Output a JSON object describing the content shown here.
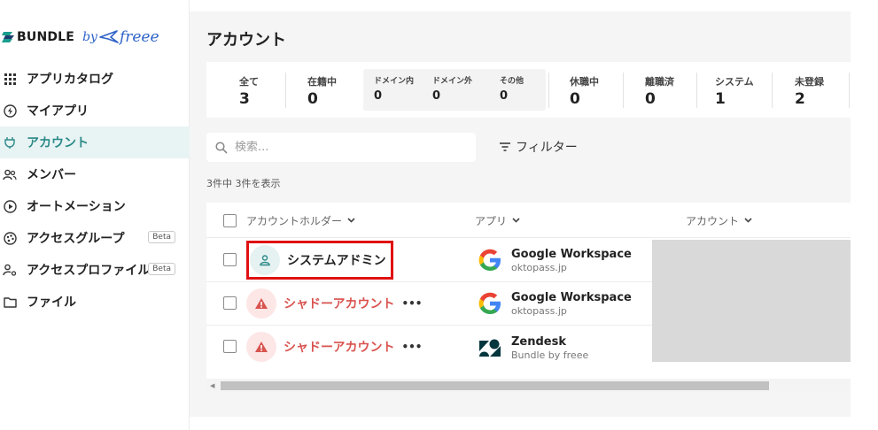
{
  "brand": {
    "word": "BUNDLE",
    "by": "by",
    "partner": "freee"
  },
  "sidebar": {
    "items": [
      {
        "label": "アプリカタログ",
        "icon": "grid-icon"
      },
      {
        "label": "マイアプリ",
        "icon": "bolt-circle-icon"
      },
      {
        "label": "アカウント",
        "icon": "plug-icon",
        "active": true
      },
      {
        "label": "メンバー",
        "icon": "people-icon"
      },
      {
        "label": "オートメーション",
        "icon": "play-circle-icon"
      },
      {
        "label": "アクセスグループ",
        "icon": "palette-icon",
        "badge": "Beta"
      },
      {
        "label": "アクセスプロファイル",
        "icon": "user-gear-icon",
        "badge": "Beta"
      },
      {
        "label": "ファイル",
        "icon": "folder-icon"
      }
    ]
  },
  "page": {
    "title": "アカウント"
  },
  "stats": [
    {
      "label": "全て",
      "value": "3"
    },
    {
      "label": "在籍中",
      "value": "0"
    },
    {
      "label": "ドメイン内",
      "value": "0"
    },
    {
      "label": "ドメイン外",
      "value": "0"
    },
    {
      "label": "その他",
      "value": "0"
    },
    {
      "label": "休職中",
      "value": "0"
    },
    {
      "label": "離職済",
      "value": "0"
    },
    {
      "label": "システム",
      "value": "1"
    },
    {
      "label": "未登録",
      "value": "2"
    }
  ],
  "search": {
    "placeholder": "検索..."
  },
  "filter": {
    "label": "フィルター"
  },
  "count_text": "3件中 3件を表示",
  "table": {
    "columns": [
      "アカウントホルダー",
      "アプリ",
      "アカウント"
    ],
    "rows": [
      {
        "holder": "システムアドミン",
        "type": "system",
        "app": "Google Workspace",
        "app_sub": "oktopass.jp",
        "app_icon": "google-icon"
      },
      {
        "holder": "シャドーアカウント",
        "type": "shadow",
        "more": "•••",
        "app": "Google Workspace",
        "app_sub": "oktopass.jp",
        "app_icon": "google-icon"
      },
      {
        "holder": "シャドーアカウント",
        "type": "shadow",
        "more": "•••",
        "app": "Zendesk",
        "app_sub": "Bundle by freee",
        "app_icon": "zendesk-icon"
      }
    ]
  },
  "colors": {
    "accent": "#2a8a88",
    "warning": "#d9534f",
    "highlight": "#e01010"
  }
}
